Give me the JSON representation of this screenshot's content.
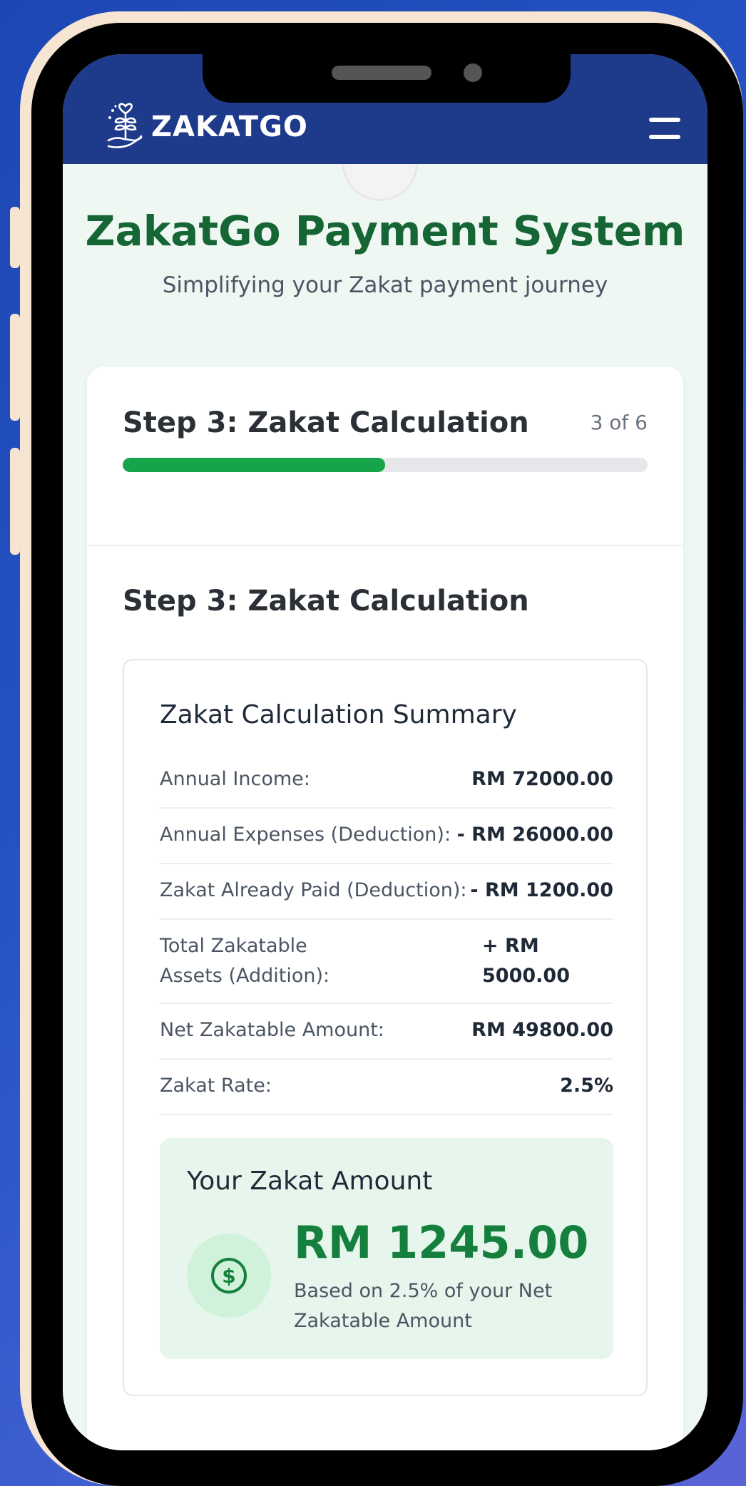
{
  "header": {
    "brand": "ZAKATGO"
  },
  "page": {
    "title": "ZakatGo Payment System",
    "subtitle": "Simplifying your Zakat payment journey"
  },
  "step": {
    "title": "Step 3: Zakat Calculation",
    "count": "3 of 6",
    "progress": 0.5
  },
  "section": {
    "title": "Step 3: Zakat Calculation"
  },
  "summary": {
    "title": "Zakat Calculation Summary",
    "rows": [
      {
        "label": "Annual Income:",
        "value": "RM 72000.00"
      },
      {
        "label": "Annual Expenses (Deduction):",
        "value": "- RM 26000.00"
      },
      {
        "label": "Zakat Already Paid (Deduction):",
        "value": "- RM 1200.00"
      },
      {
        "label": "Total Zakatable Assets (Addition):",
        "value": "+ RM 5000.00"
      },
      {
        "label": "Net Zakatable Amount:",
        "value": "RM 49800.00"
      },
      {
        "label": "Zakat Rate:",
        "value": "2.5%"
      }
    ]
  },
  "result": {
    "title": "Your Zakat Amount",
    "amount": "RM 1245.00",
    "note": "Based on 2.5% of your Net Zakatable Amount",
    "icon": "dollar-icon"
  },
  "colors": {
    "navbar": "#1e3a8a",
    "title_green": "#166534",
    "progress_green": "#16a34a",
    "amount_green": "#15803d"
  }
}
